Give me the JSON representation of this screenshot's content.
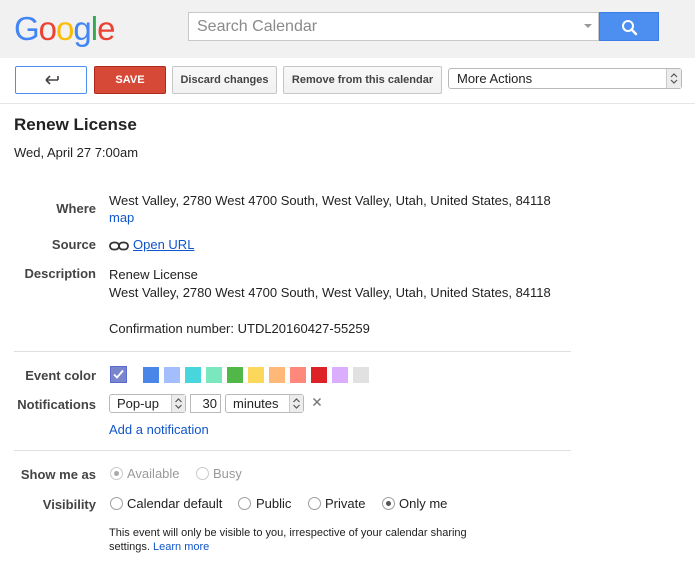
{
  "logo": {
    "letters": [
      {
        "ch": "G",
        "color": "#4285F4"
      },
      {
        "ch": "o",
        "color": "#EA4335"
      },
      {
        "ch": "o",
        "color": "#FBBC05"
      },
      {
        "ch": "g",
        "color": "#4285F4"
      },
      {
        "ch": "l",
        "color": "#34A853"
      },
      {
        "ch": "e",
        "color": "#EA4335"
      }
    ]
  },
  "search": {
    "placeholder": "Search Calendar",
    "button_icon": "search-icon"
  },
  "toolbar": {
    "back_icon": "back-arrow-icon",
    "save_label": "SAVE",
    "discard_label": "Discard changes",
    "remove_label": "Remove from this calendar",
    "more_actions": "More Actions"
  },
  "event": {
    "title": "Renew License",
    "when": "Wed, April 27 7:00am"
  },
  "details": {
    "where_label": "Where",
    "where_value": "West Valley, 2780 West 4700 South, West Valley, Utah, United States, 84118",
    "map_link": "map",
    "source_label": "Source",
    "source_icon": "link-icon",
    "source_link": "Open URL",
    "description_label": "Description",
    "description_lines": [
      "Renew License",
      "West Valley, 2780 West 4700 South, West Valley, Utah, United States, 84118",
      "",
      "Confirmation number: UTDL20160427-55259"
    ]
  },
  "color": {
    "label": "Event color",
    "selected": "#7986cb",
    "swatches": [
      "#4986e7",
      "#a4bdfc",
      "#46d6db",
      "#7ae7bf",
      "#51b749",
      "#fbd75b",
      "#ffb878",
      "#ff887c",
      "#dc2127",
      "#dbadff",
      "#e1e1e1"
    ]
  },
  "notifications": {
    "label": "Notifications",
    "method": "Pop-up",
    "amount": "30",
    "unit": "minutes",
    "remove_icon": "close-icon",
    "add_link": "Add a notification"
  },
  "show_me_as": {
    "label": "Show me as",
    "options": [
      "Available",
      "Busy"
    ],
    "selected": "Available"
  },
  "visibility": {
    "label": "Visibility",
    "options": [
      "Calendar default",
      "Public",
      "Private",
      "Only me"
    ],
    "selected": "Only me",
    "note": "This event will only be visible to you, irrespective of your calendar sharing settings.",
    "learn_more": "Learn more"
  }
}
